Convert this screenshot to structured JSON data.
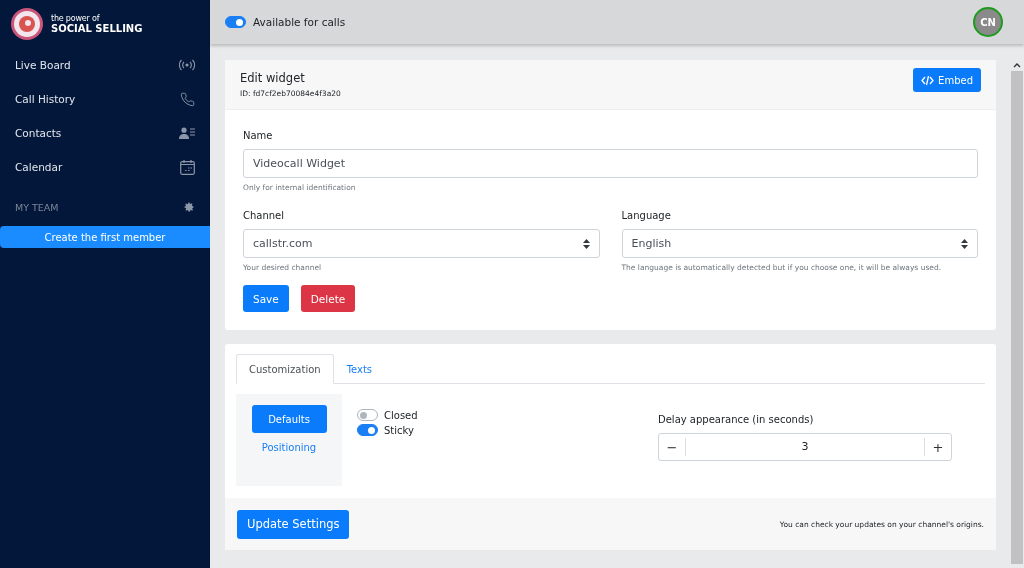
{
  "brand": {
    "tagline": "the power of",
    "name": "SOCIAL SELLING"
  },
  "sidebar": {
    "items": [
      {
        "label": "Live Board"
      },
      {
        "label": "Call History"
      },
      {
        "label": "Contacts"
      },
      {
        "label": "Calendar"
      }
    ],
    "section": "MY TEAM",
    "team_button": "Create the first member"
  },
  "topbar": {
    "availability": {
      "label": "Available for calls",
      "on": true
    },
    "avatar": "CN"
  },
  "widget": {
    "title": "Edit widget",
    "id": "ID: fd7cf2eb70084e4f3a20",
    "embed_button": "Embed",
    "name": {
      "label": "Name",
      "value": "Videocall Widget",
      "help": "Only for internal identification"
    },
    "channel": {
      "label": "Channel",
      "value": "callstr.com",
      "help": "Your desired channel"
    },
    "language": {
      "label": "Language",
      "value": "English",
      "help": "The language is automatically detected but if you choose one, it will be always used."
    },
    "save_button": "Save",
    "delete_button": "Delete"
  },
  "settings": {
    "tabs": [
      {
        "label": "Customization",
        "selected": true
      },
      {
        "label": "Texts",
        "selected": false
      }
    ],
    "pills": [
      {
        "label": "Defaults",
        "selected": true
      },
      {
        "label": "Positioning",
        "selected": false
      }
    ],
    "toggles": [
      {
        "label": "Closed",
        "on": false
      },
      {
        "label": "Sticky",
        "on": true
      }
    ],
    "delay": {
      "label": "Delay appearance (in seconds)",
      "minus": "−",
      "value": "3",
      "plus": "+"
    },
    "update_button": "Update Settings",
    "note": "You can check your updates on your channel's origins."
  }
}
